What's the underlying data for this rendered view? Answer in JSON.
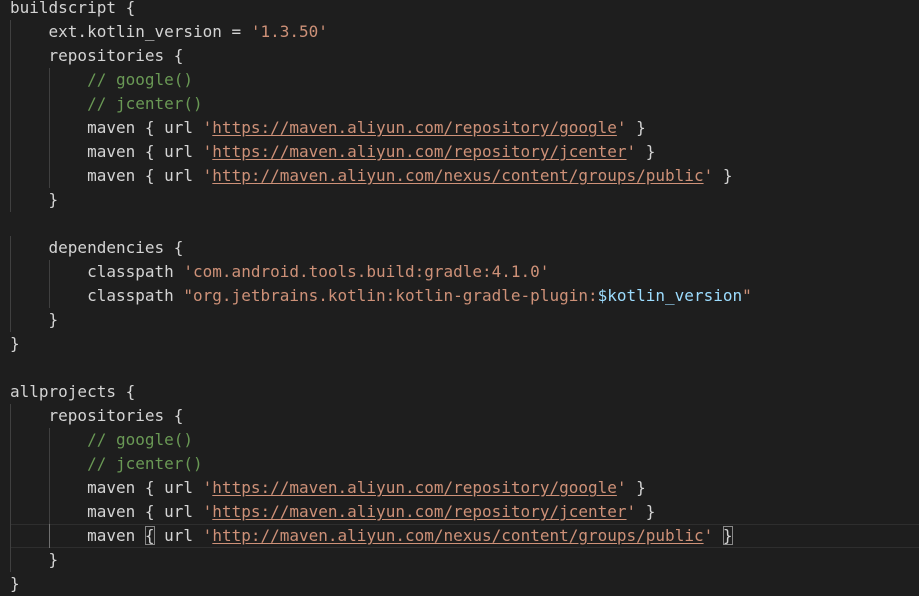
{
  "code": {
    "lines": [
      {
        "indent": 0,
        "tokens": [
          {
            "t": "buildscript {",
            "c": "tok"
          }
        ]
      },
      {
        "indent": 1,
        "tokens": [
          {
            "t": "ext.kotlin_version = ",
            "c": "tok"
          },
          {
            "t": "'1.3.50'",
            "c": "str"
          }
        ]
      },
      {
        "indent": 1,
        "tokens": [
          {
            "t": "repositories {",
            "c": "tok"
          }
        ]
      },
      {
        "indent": 2,
        "tokens": [
          {
            "t": "// google()",
            "c": "cmt"
          }
        ]
      },
      {
        "indent": 2,
        "tokens": [
          {
            "t": "// jcenter()",
            "c": "cmt"
          }
        ]
      },
      {
        "indent": 2,
        "tokens": [
          {
            "t": "maven { url ",
            "c": "tok"
          },
          {
            "t": "'",
            "c": "str"
          },
          {
            "t": "https://maven.aliyun.com/repository/google",
            "c": "link"
          },
          {
            "t": "'",
            "c": "str"
          },
          {
            "t": " }",
            "c": "tok"
          }
        ]
      },
      {
        "indent": 2,
        "tokens": [
          {
            "t": "maven { url ",
            "c": "tok"
          },
          {
            "t": "'",
            "c": "str"
          },
          {
            "t": "https://maven.aliyun.com/repository/jcenter",
            "c": "link"
          },
          {
            "t": "'",
            "c": "str"
          },
          {
            "t": " }",
            "c": "tok"
          }
        ]
      },
      {
        "indent": 2,
        "tokens": [
          {
            "t": "maven { url ",
            "c": "tok"
          },
          {
            "t": "'",
            "c": "str"
          },
          {
            "t": "http://maven.aliyun.com/nexus/content/groups/public",
            "c": "link"
          },
          {
            "t": "'",
            "c": "str"
          },
          {
            "t": " }",
            "c": "tok"
          }
        ]
      },
      {
        "indent": 1,
        "tokens": [
          {
            "t": "}",
            "c": "tok"
          }
        ]
      },
      {
        "indent": 0,
        "tokens": []
      },
      {
        "indent": 1,
        "tokens": [
          {
            "t": "dependencies {",
            "c": "tok"
          }
        ]
      },
      {
        "indent": 2,
        "tokens": [
          {
            "t": "classpath ",
            "c": "tok"
          },
          {
            "t": "'com.android.tools.build:gradle:4.1.0'",
            "c": "str"
          }
        ]
      },
      {
        "indent": 2,
        "tokens": [
          {
            "t": "classpath ",
            "c": "tok"
          },
          {
            "t": "\"org.jetbrains.kotlin:kotlin-gradle-plugin:",
            "c": "str"
          },
          {
            "t": "$kotlin_version",
            "c": "var"
          },
          {
            "t": "\"",
            "c": "str"
          }
        ]
      },
      {
        "indent": 1,
        "tokens": [
          {
            "t": "}",
            "c": "tok"
          }
        ]
      },
      {
        "indent": 0,
        "tokens": [
          {
            "t": "}",
            "c": "tok"
          }
        ]
      },
      {
        "indent": 0,
        "tokens": []
      },
      {
        "indent": 0,
        "tokens": [
          {
            "t": "allprojects {",
            "c": "tok"
          }
        ]
      },
      {
        "indent": 1,
        "tokens": [
          {
            "t": "repositories {",
            "c": "tok"
          }
        ]
      },
      {
        "indent": 2,
        "tokens": [
          {
            "t": "// google()",
            "c": "cmt"
          }
        ]
      },
      {
        "indent": 2,
        "tokens": [
          {
            "t": "// jcenter()",
            "c": "cmt"
          }
        ]
      },
      {
        "indent": 2,
        "tokens": [
          {
            "t": "maven { url ",
            "c": "tok"
          },
          {
            "t": "'",
            "c": "str"
          },
          {
            "t": "https://maven.aliyun.com/repository/google",
            "c": "link"
          },
          {
            "t": "'",
            "c": "str"
          },
          {
            "t": " }",
            "c": "tok"
          }
        ]
      },
      {
        "indent": 2,
        "tokens": [
          {
            "t": "maven { url ",
            "c": "tok"
          },
          {
            "t": "'",
            "c": "str"
          },
          {
            "t": "https://maven.aliyun.com/repository/jcenter",
            "c": "link"
          },
          {
            "t": "'",
            "c": "str"
          },
          {
            "t": " }",
            "c": "tok"
          }
        ]
      },
      {
        "indent": 2,
        "current": true,
        "tokens": [
          {
            "t": "maven ",
            "c": "tok"
          },
          {
            "t": "{",
            "c": "tok",
            "bm": true
          },
          {
            "t": " url ",
            "c": "tok"
          },
          {
            "t": "'",
            "c": "str"
          },
          {
            "t": "http://maven.aliyun.com/nexus/content/groups/public",
            "c": "link"
          },
          {
            "t": "'",
            "c": "str"
          },
          {
            "t": " ",
            "c": "tok"
          },
          {
            "t": "}",
            "c": "tok",
            "bm": true
          }
        ]
      },
      {
        "indent": 1,
        "tokens": [
          {
            "t": "}",
            "c": "tok"
          }
        ]
      },
      {
        "indent": 0,
        "tokens": [
          {
            "t": "}",
            "c": "tok"
          }
        ]
      }
    ]
  },
  "colors": {
    "background": "#1e1e1e",
    "text": "#d4d4d4",
    "string": "#ce9178",
    "comment": "#6a9955",
    "variable": "#9cdcfe",
    "indent_guide": "#404040"
  }
}
